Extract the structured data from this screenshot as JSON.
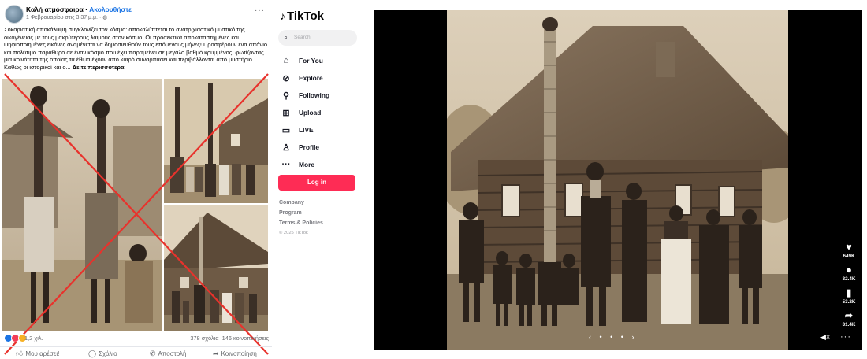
{
  "facebook": {
    "page_name": "Καλή ατμόσφαιρα",
    "separator": " · ",
    "follow_label": "Ακολουθήστε",
    "post_date": "1 Φεβρουαρίου στις 3:37 μ.μ. · ",
    "globe_icon": "globe-icon",
    "more_label": "···",
    "post_text": "Σοκαριστική αποκάλυψη συγκλονίζει τον κόσμο: αποκαλύπτεται το ανατριχιαστικό μυστικό της οικογένειας με τους μακρύτερους λαιμούς στον κόσμο. Οι προσεκτικά αποκαταστημένες και ψηφιοποιημένες εικόνες αναμένεται να δημοσιευθούν τους επόμενους μήνες! Προσφέρουν ένα σπάνιο και πολύτιμο παράθυρο σε έναν κόσμο που έχει παραμείνει σε μεγάλο βαθμό κρυμμένος, φωτίζοντας μια κοινότητα της οποίας τα έθιμα έχουν από καιρό συναρπάσει και περιβάλλονται από μυστήριο. Καθώς οι ιστορικοί και ο...",
    "see_more_label": "Δείτε περισσότερα",
    "reaction_count": "1,2 χιλ.",
    "comments_count": "378 σχόλια",
    "shares_count": "146 κοινοποιήσεις",
    "actions": {
      "like": "Μου αρέσει!",
      "comment": "Σχόλιο",
      "send": "Αποστολή",
      "share": "Κοινοποίηση"
    },
    "cross_color": "#e8322c"
  },
  "tiktok": {
    "brand": "TikTok",
    "search_placeholder": "Search",
    "nav": [
      {
        "label": "For You",
        "icon": "home-icon"
      },
      {
        "label": "Explore",
        "icon": "compass-icon"
      },
      {
        "label": "Following",
        "icon": "following-icon"
      },
      {
        "label": "Upload",
        "icon": "upload-icon"
      },
      {
        "label": "LIVE",
        "icon": "live-icon"
      },
      {
        "label": "Profile",
        "icon": "profile-icon"
      },
      {
        "label": "More",
        "icon": "more-icon"
      }
    ],
    "login_label": "Log in",
    "login_color": "#fe2c55",
    "footer": {
      "company": "Company",
      "program": "Program",
      "terms": "Terms & Policies",
      "copyright": "© 2025 TikTok"
    },
    "rail": {
      "likes": "649K",
      "comments": "32.4K",
      "saves": "53.2K",
      "shares": "31.4K"
    },
    "carousel_nav": "‹ • • • ›"
  }
}
